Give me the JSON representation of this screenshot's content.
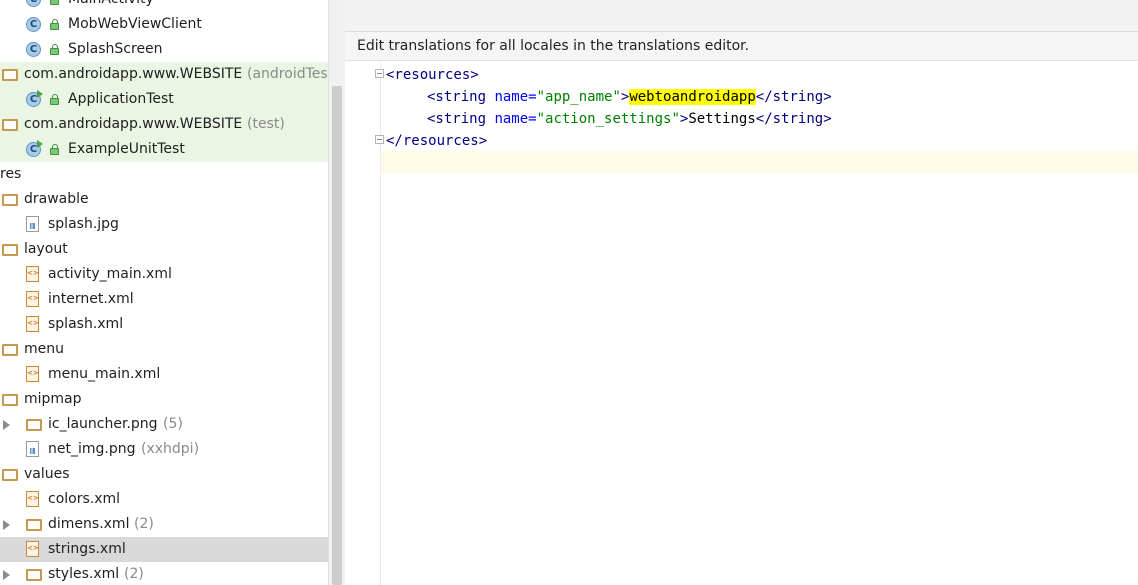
{
  "tree": {
    "rows": [
      {
        "label": "MainActivity",
        "suffix": "",
        "icon": "class-icon",
        "access": true,
        "indent": 1,
        "test": false
      },
      {
        "label": "MobWebViewClient",
        "suffix": "",
        "icon": "class-icon",
        "access": true,
        "indent": 1,
        "test": false
      },
      {
        "label": "SplashScreen",
        "suffix": "",
        "icon": "class-icon",
        "access": true,
        "indent": 1,
        "test": false
      },
      {
        "label": "com.androidapp.www.WEBSITE",
        "suffix": "(androidTest)",
        "icon": "folder-icon",
        "indent": 0,
        "test": true
      },
      {
        "label": "ApplicationTest",
        "suffix": "",
        "icon": "test-class-icon",
        "access": true,
        "indent": 1,
        "test": true
      },
      {
        "label": "com.androidapp.www.WEBSITE",
        "suffix": "(test)",
        "icon": "folder-icon",
        "indent": 0,
        "test": true
      },
      {
        "label": "ExampleUnitTest",
        "suffix": "",
        "icon": "test-class-icon",
        "access": true,
        "indent": 1,
        "test": true
      },
      {
        "label": "res",
        "suffix": "",
        "icon": "none",
        "indent": -1
      },
      {
        "label": "drawable",
        "suffix": "",
        "icon": "folder-icon",
        "indent": 0
      },
      {
        "label": "splash.jpg",
        "suffix": "",
        "icon": "image-file-icon",
        "indent": 1
      },
      {
        "label": "layout",
        "suffix": "",
        "icon": "folder-icon",
        "indent": 0
      },
      {
        "label": "activity_main.xml",
        "suffix": "",
        "icon": "xml-file-icon",
        "indent": 1
      },
      {
        "label": "internet.xml",
        "suffix": "",
        "icon": "xml-file-icon",
        "indent": 1
      },
      {
        "label": "splash.xml",
        "suffix": "",
        "icon": "xml-file-icon",
        "indent": 1
      },
      {
        "label": "menu",
        "suffix": "",
        "icon": "folder-icon",
        "indent": 0
      },
      {
        "label": "menu_main.xml",
        "suffix": "",
        "icon": "xml-file-icon",
        "indent": 1
      },
      {
        "label": "mipmap",
        "suffix": "",
        "icon": "folder-icon",
        "indent": 0
      },
      {
        "label": "ic_launcher.png",
        "suffix": "(5)",
        "icon": "folder-icon",
        "indent": 1,
        "expandable": true
      },
      {
        "label": "net_img.png",
        "suffix": "(xxhdpi)",
        "icon": "image-file-icon",
        "indent": 1
      },
      {
        "label": "values",
        "suffix": "",
        "icon": "folder-icon",
        "indent": 0
      },
      {
        "label": "colors.xml",
        "suffix": "",
        "icon": "xml-file-icon",
        "indent": 1
      },
      {
        "label": "dimens.xml",
        "suffix": "(2)",
        "icon": "folder-icon",
        "indent": 1,
        "expandable": true
      },
      {
        "label": "strings.xml",
        "suffix": "",
        "icon": "xml-file-icon",
        "indent": 1,
        "selected": true
      },
      {
        "label": "styles.xml",
        "suffix": "(2)",
        "icon": "folder-icon",
        "indent": 1,
        "expandable": true
      }
    ]
  },
  "editor": {
    "banner": "Edit translations for all locales in the translations editor.",
    "code": {
      "l1_open": "<resources>",
      "l2_open": "<string ",
      "l2_attr": "name=",
      "l2_val": "\"app_name\"",
      "l2_gt": ">",
      "l2_text": "webtoandroidapp",
      "l2_close": "</string>",
      "l3_open": "<string ",
      "l3_attr": "name=",
      "l3_val": "\"action_settings\"",
      "l3_gt": ">",
      "l3_text": "Settings",
      "l3_close": "</string>",
      "l4_close": "</resources>"
    },
    "highlight_color": "#ffff00"
  }
}
